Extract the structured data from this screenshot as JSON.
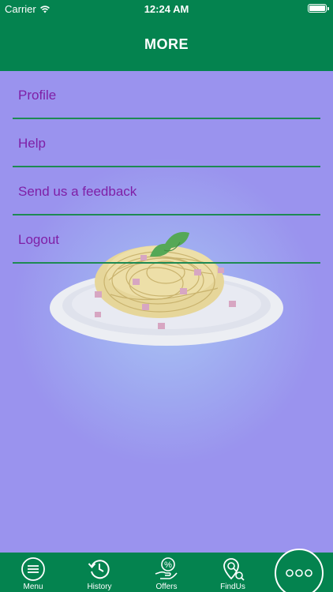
{
  "status": {
    "carrier": "Carrier",
    "time": "12:24 AM"
  },
  "nav": {
    "title": "MORE"
  },
  "menu": [
    {
      "label": "Profile"
    },
    {
      "label": "Help"
    },
    {
      "label": "Send us a feedback"
    },
    {
      "label": "Logout"
    }
  ],
  "tabs": [
    {
      "label": "Menu",
      "icon": "menu-icon"
    },
    {
      "label": "History",
      "icon": "history-icon"
    },
    {
      "label": "Offers",
      "icon": "offers-icon"
    },
    {
      "label": "FindUs",
      "icon": "findus-icon"
    },
    {
      "icon": "more-icon"
    }
  ],
  "colors": {
    "primary": "#04834f",
    "background": "#9a93ee",
    "menu_text": "#7f1fa6",
    "divider": "#1e8a53"
  }
}
